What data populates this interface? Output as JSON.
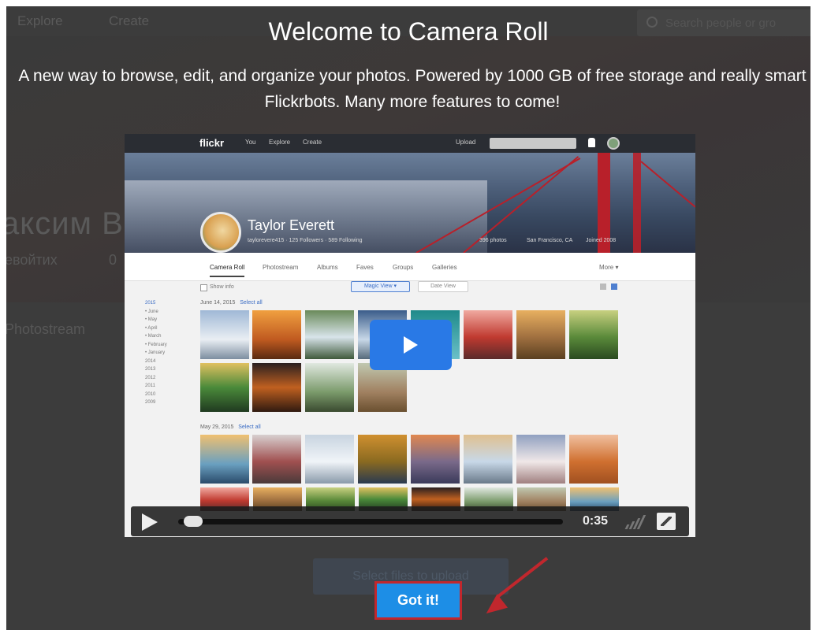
{
  "background": {
    "nav": [
      "Explore",
      "Create"
    ],
    "search_placeholder": "Search people or gro",
    "profile_name": "аксим В",
    "profile_sub": "евойтих",
    "profile_count": "0",
    "tab": "Photostream",
    "upload_button": "Select files to upload"
  },
  "modal": {
    "title": "Welcome to Camera Roll",
    "description": "A new way to browse, edit, and organize your photos. Powered by 1000 GB of free storage and really smart Flickrbots. Many more features to come!",
    "got_it_label": "Got it!"
  },
  "video": {
    "time": "0:35",
    "progress": 0.01,
    "flickr": {
      "logo": "flickr",
      "nav": [
        "You",
        "Explore",
        "Create"
      ],
      "upload": "Upload",
      "profile_name": "Taylor Everett",
      "profile_meta": "taylorevere415 · 125 Followers · 589 Following",
      "stats": [
        "396 photos",
        "San Francisco, CA",
        "Joined 2008"
      ],
      "tabs": [
        "Camera Roll",
        "Photostream",
        "Albums",
        "Faves",
        "Groups",
        "Galleries",
        "More ▾"
      ],
      "show_info": "Show info",
      "btn_magic_view": "Magic View ▾",
      "btn_date_view": "Date View",
      "years": [
        "2015",
        "• June",
        "• May",
        "• April",
        "• March",
        "• February",
        "• January",
        "2014",
        "2013",
        "2012",
        "2011",
        "2010",
        "2009"
      ],
      "sections": [
        {
          "date": "June 14, 2015",
          "select": "Select all"
        },
        {
          "date": "May 29, 2015",
          "select": "Select all"
        }
      ]
    }
  }
}
